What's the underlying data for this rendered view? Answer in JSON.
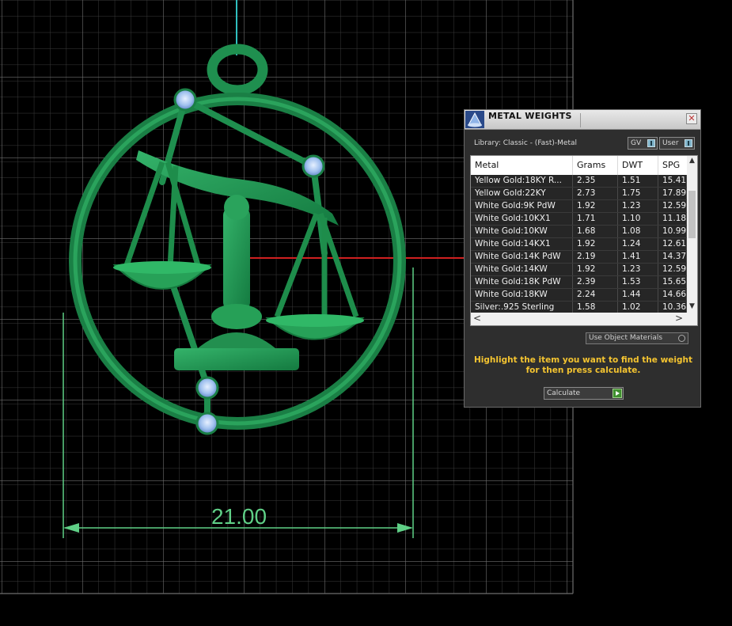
{
  "viewport": {
    "dimension_label": "21.00",
    "colors": {
      "background": "#000000",
      "grid": "#8a8a8a",
      "model_green": "#1f8f4f",
      "dimension_green": "#5fcf86",
      "axis_red": "#d02020",
      "axis_cyan": "#2fbfbf",
      "gem_blue": "#a8c8f0"
    }
  },
  "panel": {
    "title": "METAL WEIGHTS",
    "close_glyph": "✕",
    "library_label": "Library: Classic - (Fast)-Metal",
    "toggle_gv": "GV",
    "toggle_user": "User",
    "table": {
      "columns": [
        "Metal",
        "Grams",
        "DWT",
        "SPG"
      ],
      "rows": [
        {
          "metal": "Yellow Gold:18KY R...",
          "grams": "2.35",
          "dwt": "1.51",
          "spg": "15.41"
        },
        {
          "metal": "Yellow Gold:22KY",
          "grams": "2.73",
          "dwt": "1.75",
          "spg": "17.89"
        },
        {
          "metal": "White Gold:9K PdW",
          "grams": "1.92",
          "dwt": "1.23",
          "spg": "12.59"
        },
        {
          "metal": "White Gold:10KX1",
          "grams": "1.71",
          "dwt": "1.10",
          "spg": "11.18"
        },
        {
          "metal": "White Gold:10KW",
          "grams": "1.68",
          "dwt": "1.08",
          "spg": "10.99"
        },
        {
          "metal": "White Gold:14KX1",
          "grams": "1.92",
          "dwt": "1.24",
          "spg": "12.61"
        },
        {
          "metal": "White Gold:14K PdW",
          "grams": "2.19",
          "dwt": "1.41",
          "spg": "14.37"
        },
        {
          "metal": "White Gold:14KW",
          "grams": "1.92",
          "dwt": "1.23",
          "spg": "12.59"
        },
        {
          "metal": "White Gold:18K PdW",
          "grams": "2.39",
          "dwt": "1.53",
          "spg": "15.65"
        },
        {
          "metal": "White Gold:18KW",
          "grams": "2.24",
          "dwt": "1.44",
          "spg": "14.66"
        },
        {
          "metal": "Silver:.925 Sterling",
          "grams": "1.58",
          "dwt": "1.02",
          "spg": "10.36"
        }
      ]
    },
    "scroll_up_glyph": "▲",
    "scroll_down_glyph": "▼",
    "scroll_left_glyph": "<",
    "scroll_right_glyph": ">",
    "use_object_materials": "Use Object Materials",
    "instruction": "Highlight the item you want to find the weight for then press calculate.",
    "calculate_label": "Calculate",
    "colors": {
      "instruction_text": "#f4c430",
      "panel_bg": "#2e2e2e",
      "row_bg": "#262626",
      "calc_go": "#3f8f2f"
    }
  }
}
